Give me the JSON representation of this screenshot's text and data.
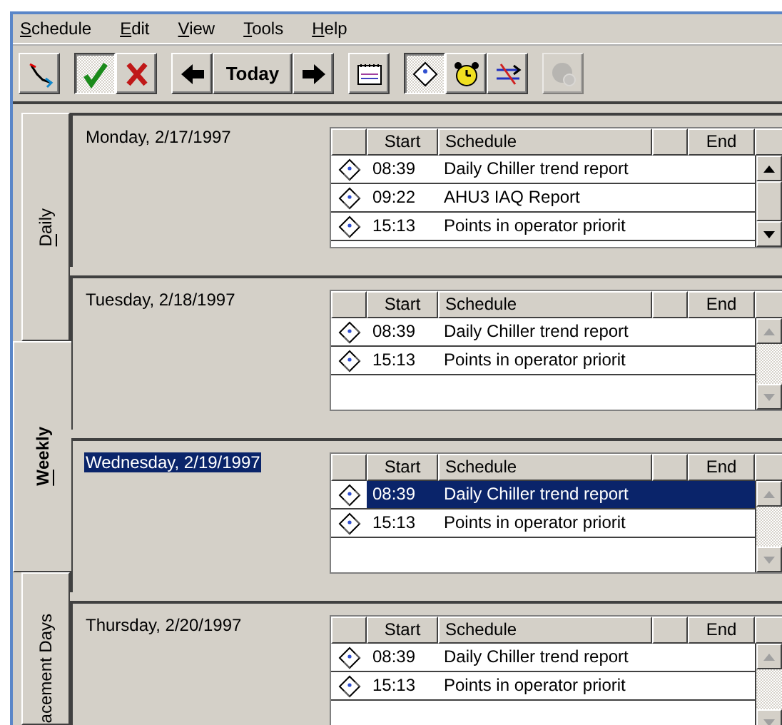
{
  "menu": [
    {
      "label": "Schedule"
    },
    {
      "label": "Edit"
    },
    {
      "label": "View"
    },
    {
      "label": "Tools"
    },
    {
      "label": "Help"
    }
  ],
  "toolbar": {
    "groups": [
      {
        "buttons": [
          {
            "kind": "icon",
            "pressed": false,
            "disabled": false
          }
        ]
      },
      {
        "buttons": [
          {
            "kind": "icon",
            "pressed": true,
            "disabled": false
          },
          {
            "kind": "icon",
            "pressed": false,
            "disabled": false
          }
        ]
      },
      {
        "buttons": [
          {
            "kind": "icon",
            "pressed": false,
            "disabled": false
          },
          {
            "kind": "text",
            "label": "Today",
            "pressed": false,
            "disabled": false
          },
          {
            "kind": "icon",
            "pressed": false,
            "disabled": false
          }
        ]
      },
      {
        "buttons": [
          {
            "kind": "icon",
            "pressed": false,
            "disabled": false
          }
        ]
      },
      {
        "buttons": [
          {
            "kind": "icon",
            "pressed": true,
            "disabled": false
          },
          {
            "kind": "icon",
            "pressed": false,
            "disabled": false
          },
          {
            "kind": "icon",
            "pressed": false,
            "disabled": false
          }
        ]
      },
      {
        "buttons": [
          {
            "kind": "icon",
            "pressed": false,
            "disabled": true
          }
        ]
      }
    ]
  },
  "tabs": [
    {
      "label": "Daily",
      "selected": false
    },
    {
      "label": "Weekly",
      "selected": true
    },
    {
      "label": "acement Days",
      "selected": false
    }
  ],
  "days": [
    {
      "date": "Monday, 2/17/1997",
      "date_selected": false,
      "columns": [
        "Start",
        "Schedule",
        "End"
      ],
      "scroll_enabled": true,
      "rows": [
        {
          "start": "08:39",
          "schedule": "Daily Chiller trend report",
          "selected": false
        },
        {
          "start": "09:22",
          "schedule": "AHU3 IAQ Report",
          "selected": false
        },
        {
          "start": "15:13",
          "schedule": "Points in operator priorit",
          "selected": false
        }
      ]
    },
    {
      "date": "Tuesday, 2/18/1997",
      "date_selected": false,
      "columns": [
        "Start",
        "Schedule",
        "End"
      ],
      "scroll_enabled": false,
      "rows": [
        {
          "start": "08:39",
          "schedule": "Daily Chiller trend report",
          "selected": false
        },
        {
          "start": "15:13",
          "schedule": "Points in operator priorit",
          "selected": false
        }
      ]
    },
    {
      "date": "Wednesday, 2/19/1997",
      "date_selected": true,
      "columns": [
        "Start",
        "Schedule",
        "End"
      ],
      "scroll_enabled": false,
      "rows": [
        {
          "start": "08:39",
          "schedule": "Daily Chiller trend report",
          "selected": true
        },
        {
          "start": "15:13",
          "schedule": "Points in operator priorit",
          "selected": false
        }
      ]
    },
    {
      "date": "Thursday, 2/20/1997",
      "date_selected": false,
      "columns": [
        "Start",
        "Schedule",
        "End"
      ],
      "scroll_enabled": false,
      "rows": [
        {
          "start": "08:39",
          "schedule": "Daily Chiller trend report",
          "selected": false
        },
        {
          "start": "15:13",
          "schedule": "Points in operator priorit",
          "selected": false
        }
      ]
    }
  ]
}
